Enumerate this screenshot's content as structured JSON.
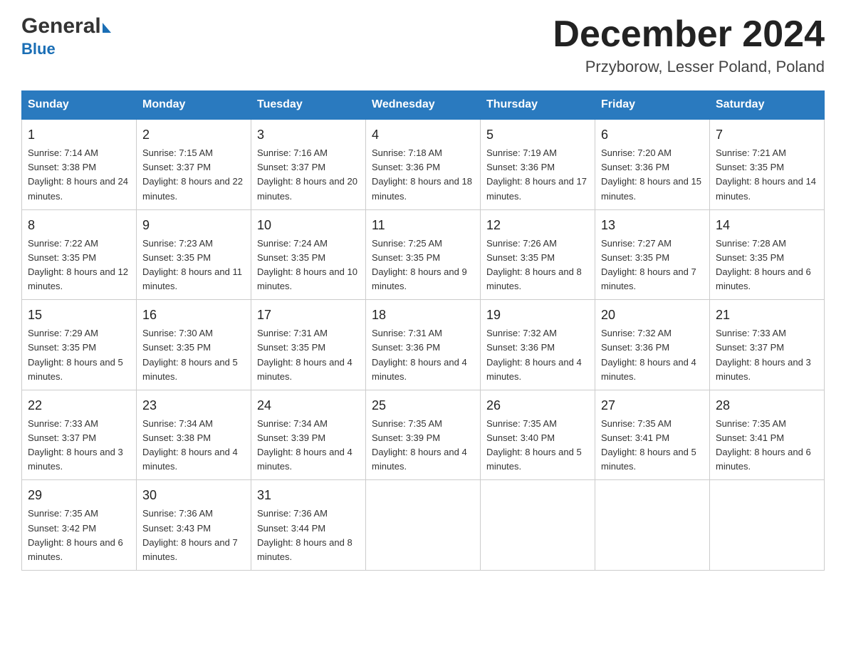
{
  "logo": {
    "general": "General",
    "blue": "Blue",
    "arrow": "▶"
  },
  "header": {
    "month": "December 2024",
    "location": "Przyborow, Lesser Poland, Poland"
  },
  "days_of_week": [
    "Sunday",
    "Monday",
    "Tuesday",
    "Wednesday",
    "Thursday",
    "Friday",
    "Saturday"
  ],
  "weeks": [
    [
      {
        "day": "1",
        "sunrise": "7:14 AM",
        "sunset": "3:38 PM",
        "daylight": "8 hours and 24 minutes."
      },
      {
        "day": "2",
        "sunrise": "7:15 AM",
        "sunset": "3:37 PM",
        "daylight": "8 hours and 22 minutes."
      },
      {
        "day": "3",
        "sunrise": "7:16 AM",
        "sunset": "3:37 PM",
        "daylight": "8 hours and 20 minutes."
      },
      {
        "day": "4",
        "sunrise": "7:18 AM",
        "sunset": "3:36 PM",
        "daylight": "8 hours and 18 minutes."
      },
      {
        "day": "5",
        "sunrise": "7:19 AM",
        "sunset": "3:36 PM",
        "daylight": "8 hours and 17 minutes."
      },
      {
        "day": "6",
        "sunrise": "7:20 AM",
        "sunset": "3:36 PM",
        "daylight": "8 hours and 15 minutes."
      },
      {
        "day": "7",
        "sunrise": "7:21 AM",
        "sunset": "3:35 PM",
        "daylight": "8 hours and 14 minutes."
      }
    ],
    [
      {
        "day": "8",
        "sunrise": "7:22 AM",
        "sunset": "3:35 PM",
        "daylight": "8 hours and 12 minutes."
      },
      {
        "day": "9",
        "sunrise": "7:23 AM",
        "sunset": "3:35 PM",
        "daylight": "8 hours and 11 minutes."
      },
      {
        "day": "10",
        "sunrise": "7:24 AM",
        "sunset": "3:35 PM",
        "daylight": "8 hours and 10 minutes."
      },
      {
        "day": "11",
        "sunrise": "7:25 AM",
        "sunset": "3:35 PM",
        "daylight": "8 hours and 9 minutes."
      },
      {
        "day": "12",
        "sunrise": "7:26 AM",
        "sunset": "3:35 PM",
        "daylight": "8 hours and 8 minutes."
      },
      {
        "day": "13",
        "sunrise": "7:27 AM",
        "sunset": "3:35 PM",
        "daylight": "8 hours and 7 minutes."
      },
      {
        "day": "14",
        "sunrise": "7:28 AM",
        "sunset": "3:35 PM",
        "daylight": "8 hours and 6 minutes."
      }
    ],
    [
      {
        "day": "15",
        "sunrise": "7:29 AM",
        "sunset": "3:35 PM",
        "daylight": "8 hours and 5 minutes."
      },
      {
        "day": "16",
        "sunrise": "7:30 AM",
        "sunset": "3:35 PM",
        "daylight": "8 hours and 5 minutes."
      },
      {
        "day": "17",
        "sunrise": "7:31 AM",
        "sunset": "3:35 PM",
        "daylight": "8 hours and 4 minutes."
      },
      {
        "day": "18",
        "sunrise": "7:31 AM",
        "sunset": "3:36 PM",
        "daylight": "8 hours and 4 minutes."
      },
      {
        "day": "19",
        "sunrise": "7:32 AM",
        "sunset": "3:36 PM",
        "daylight": "8 hours and 4 minutes."
      },
      {
        "day": "20",
        "sunrise": "7:32 AM",
        "sunset": "3:36 PM",
        "daylight": "8 hours and 4 minutes."
      },
      {
        "day": "21",
        "sunrise": "7:33 AM",
        "sunset": "3:37 PM",
        "daylight": "8 hours and 3 minutes."
      }
    ],
    [
      {
        "day": "22",
        "sunrise": "7:33 AM",
        "sunset": "3:37 PM",
        "daylight": "8 hours and 3 minutes."
      },
      {
        "day": "23",
        "sunrise": "7:34 AM",
        "sunset": "3:38 PM",
        "daylight": "8 hours and 4 minutes."
      },
      {
        "day": "24",
        "sunrise": "7:34 AM",
        "sunset": "3:39 PM",
        "daylight": "8 hours and 4 minutes."
      },
      {
        "day": "25",
        "sunrise": "7:35 AM",
        "sunset": "3:39 PM",
        "daylight": "8 hours and 4 minutes."
      },
      {
        "day": "26",
        "sunrise": "7:35 AM",
        "sunset": "3:40 PM",
        "daylight": "8 hours and 5 minutes."
      },
      {
        "day": "27",
        "sunrise": "7:35 AM",
        "sunset": "3:41 PM",
        "daylight": "8 hours and 5 minutes."
      },
      {
        "day": "28",
        "sunrise": "7:35 AM",
        "sunset": "3:41 PM",
        "daylight": "8 hours and 6 minutes."
      }
    ],
    [
      {
        "day": "29",
        "sunrise": "7:35 AM",
        "sunset": "3:42 PM",
        "daylight": "8 hours and 6 minutes."
      },
      {
        "day": "30",
        "sunrise": "7:36 AM",
        "sunset": "3:43 PM",
        "daylight": "8 hours and 7 minutes."
      },
      {
        "day": "31",
        "sunrise": "7:36 AM",
        "sunset": "3:44 PM",
        "daylight": "8 hours and 8 minutes."
      },
      null,
      null,
      null,
      null
    ]
  ]
}
